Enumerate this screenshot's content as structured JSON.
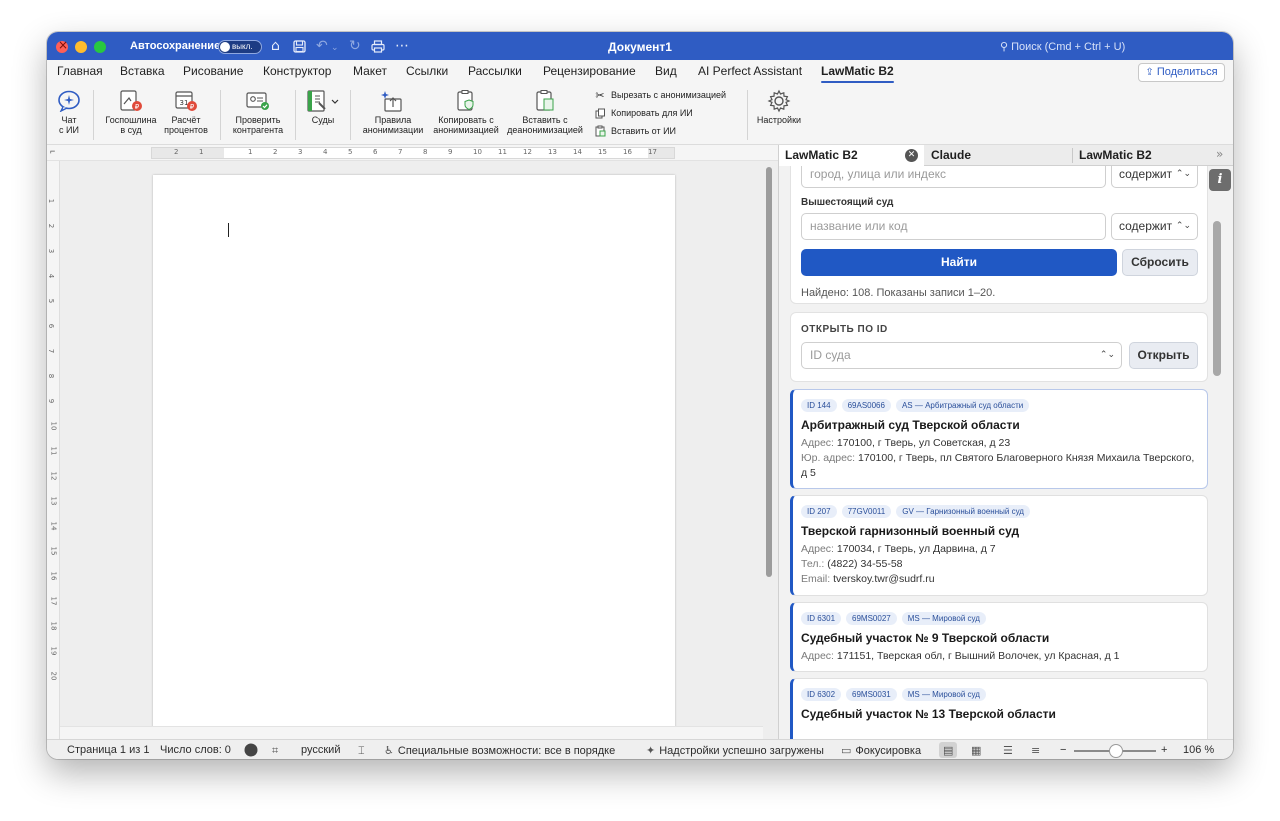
{
  "titlebar": {
    "autosave_label": "Автосохранение",
    "autosave_state": "выкл.",
    "document_title": "Документ1",
    "search_placeholder": "Поиск (Cmd + Ctrl + U)"
  },
  "ribbon_tabs": [
    {
      "label": "Главная"
    },
    {
      "label": "Вставка"
    },
    {
      "label": "Рисование"
    },
    {
      "label": "Конструктор"
    },
    {
      "label": "Макет"
    },
    {
      "label": "Ссылки"
    },
    {
      "label": "Рассылки"
    },
    {
      "label": "Рецензирование"
    },
    {
      "label": "Вид"
    },
    {
      "label": "AI Perfect Assistant"
    },
    {
      "label": "LawMatic B2"
    }
  ],
  "active_ribbon_tab": "LawMatic B2",
  "share_label": "Поделиться",
  "ribbon": {
    "chat": "Чат\nс ИИ",
    "fee": "Госпошлина\nв суд",
    "interest": "Расчёт\nпроцентов",
    "counterparty": "Проверить\nконтрагента",
    "courts": "Суды",
    "anon_rules": "Правила\nанонимизации",
    "copy_anon": "Копировать с\nанонимизацией",
    "paste_deanon": "Вставить с\nдеанонимизацией",
    "cut_anon": "Вырезать с анонимизацией",
    "copy_for_ai": "Копировать для ИИ",
    "paste_from_ai": "Вставить от ИИ",
    "settings": "Настройки"
  },
  "ruler": {
    "left_labels": [
      "2",
      "1"
    ],
    "labels": [
      "1",
      "2",
      "3",
      "4",
      "5",
      "6",
      "7",
      "8",
      "9",
      "10",
      "11",
      "12",
      "13",
      "14",
      "15",
      "16",
      "17"
    ],
    "vertical_labels": [
      "1",
      "2",
      "3",
      "4",
      "5",
      "6",
      "7",
      "8",
      "9",
      "10",
      "11",
      "12",
      "13",
      "14",
      "15",
      "16",
      "17",
      "18",
      "19",
      "20"
    ]
  },
  "status": {
    "page": "Страница 1 из 1",
    "words": "Число слов: 0",
    "language": "русский",
    "accessibility": "Специальные возможности: все в порядке",
    "addins": "Надстройки успешно загружены",
    "focus": "Фокусировка",
    "zoom": "106 %"
  },
  "panel": {
    "tabs": [
      "LawMatic B2",
      "Claude",
      "LawMatic B2"
    ],
    "address_placeholder": "город, улица или индекс",
    "match_mode": "содержит",
    "higher_court_label": "Вышестоящий суд",
    "higher_court_placeholder": "название или код",
    "find_label": "Найти",
    "reset_label": "Сбросить",
    "found_text": "Найдено: 108. Показаны записи 1–20.",
    "open_by_id_title": "ОТКРЫТЬ ПО ID",
    "id_placeholder": "ID суда",
    "open_label": "Открыть",
    "results": [
      {
        "chips": [
          "ID 144",
          "69AS0066",
          "AS — Арбитражный суд области"
        ],
        "title": "Арбитражный суд Тверской области",
        "lines": [
          {
            "key": "Адрес:",
            "value": "170100, г Тверь, ул Советская, д 23"
          },
          {
            "key": "Юр. адрес:",
            "value": "170100, г Тверь, пл Святого Благоверного Князя Михаила Тверского, д 5"
          }
        ]
      },
      {
        "chips": [
          "ID 207",
          "77GV0011",
          "GV — Гарнизонный военный суд"
        ],
        "title": "Тверской гарнизонный военный суд",
        "lines": [
          {
            "key": "Адрес:",
            "value": "170034, г Тверь, ул Дарвина, д 7"
          },
          {
            "key": "Тел.:",
            "value": "(4822) 34-55-58"
          },
          {
            "key": "Email:",
            "value": "tverskoy.twr@sudrf.ru"
          }
        ]
      },
      {
        "chips": [
          "ID 6301",
          "69MS0027",
          "MS — Мировой суд"
        ],
        "title": "Судебный участок № 9 Тверской области",
        "lines": [
          {
            "key": "Адрес:",
            "value": "171151, Тверская обл, г Вышний Волочек, ул Красная, д 1"
          }
        ]
      },
      {
        "chips": [
          "ID 6302",
          "69MS0031",
          "MS — Мировой суд"
        ],
        "title": "Судебный участок № 13 Тверской области",
        "lines": []
      }
    ]
  },
  "colors": {
    "titlebar": "#2f5cc3",
    "accent": "#2058c4"
  }
}
